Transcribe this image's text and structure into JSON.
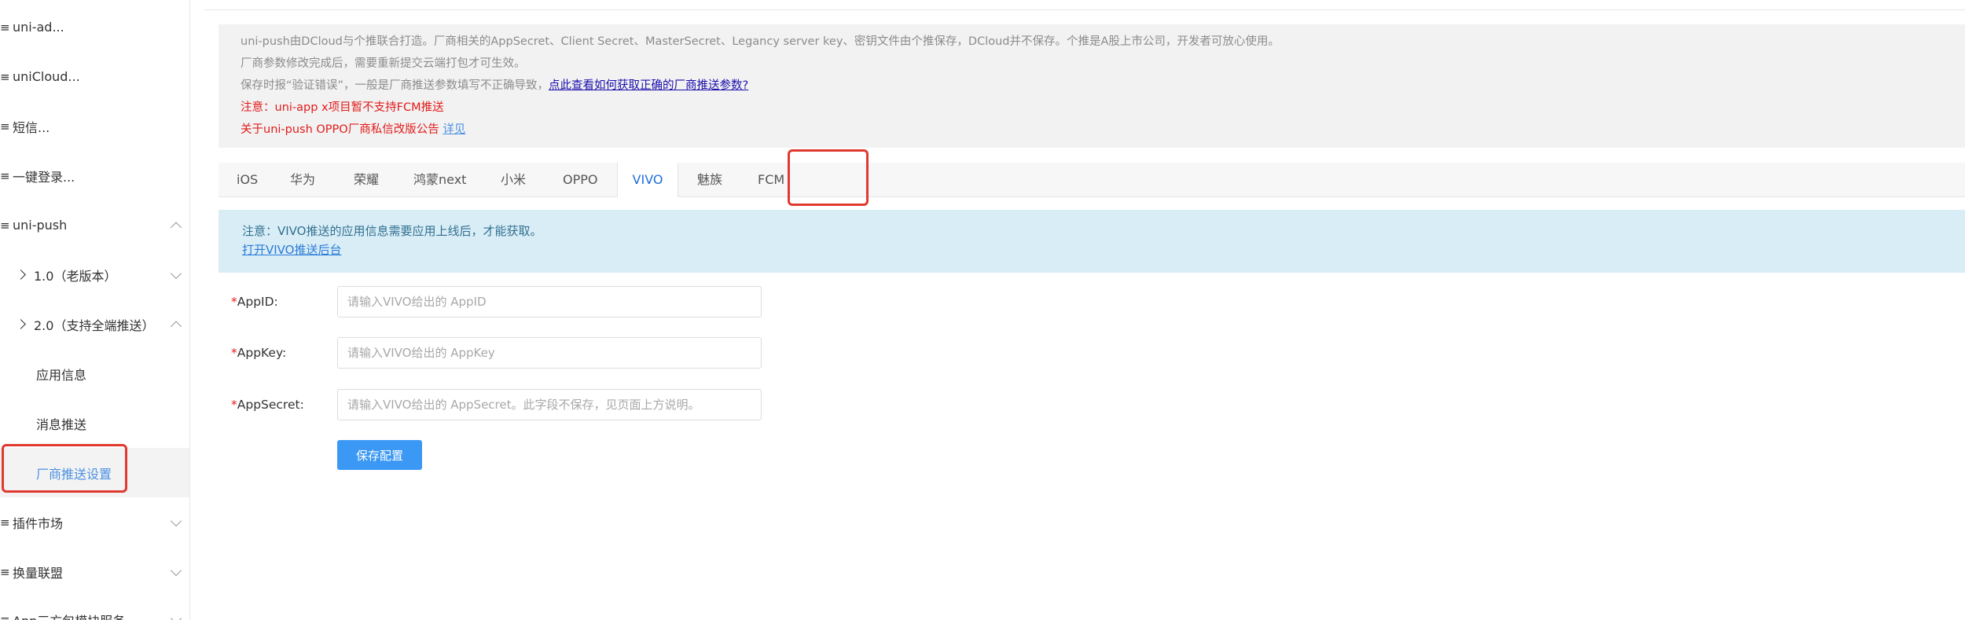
{
  "sidebar": {
    "items": [
      {
        "label": "uni-ad..."
      },
      {
        "label": "uniCloud..."
      },
      {
        "label": "短信..."
      },
      {
        "label": "一键登录..."
      },
      {
        "label": "uni-push"
      },
      {
        "label": "1.0（老版本）"
      },
      {
        "label": "2.0（支持全端推送）"
      },
      {
        "label": "应用信息"
      },
      {
        "label": "消息推送"
      },
      {
        "label": "厂商推送设置"
      },
      {
        "label": "插件市场"
      },
      {
        "label": "换量联盟"
      },
      {
        "label": "App三方包模块服务..."
      }
    ]
  },
  "notice": {
    "line1": "uni-push由DCloud与个推联合打造。厂商相关的AppSecret、Client Secret、MasterSecret、Legancy server key、密钥文件由个推保存，DCloud并不保存。个推是A股上市公司，开发者可放心使用。",
    "line2": "厂商参数修改完成后，需要重新提交云端打包才可生效。",
    "line3_prefix": "保存时报“验证错误”，一般是厂商推送参数填写不正确导致，",
    "line3_link": "点此查看如何获取正确的厂商推送参数?",
    "line4": "注意：uni-app x项目暂不支持FCM推送",
    "line5_prefix": "关于uni-push OPPO厂商私信改版公告 ",
    "line5_link": "详见"
  },
  "tabs": [
    "iOS",
    "华为",
    "荣耀",
    "鸿蒙next",
    "小米",
    "OPPO",
    "VIVO",
    "魅族",
    "FCM"
  ],
  "active_tab": "VIVO",
  "info": {
    "text": "注意：VIVO推送的应用信息需要应用上线后，才能获取。",
    "link": "打开VIVO推送后台"
  },
  "form": {
    "required_mark": "*",
    "appid_label": "AppID:",
    "appid_placeholder": "请输入VIVO给出的 AppID",
    "appkey_label": "AppKey:",
    "appkey_placeholder": "请输入VIVO给出的 AppKey",
    "appsecret_label": "AppSecret:",
    "appsecret_placeholder": "请输入VIVO给出的 AppSecret。此字段不保存，见页面上方说明。",
    "save_label": "保存配置"
  },
  "icons": {
    "menu": "menu-lines-icon",
    "caret": "chevron-icon"
  },
  "colors": {
    "accent": "#4a90e2",
    "highlight_box": "#e0392f",
    "error_text": "#e21b1b",
    "button": "#3b98f4",
    "info_bg": "#d9edf7"
  }
}
